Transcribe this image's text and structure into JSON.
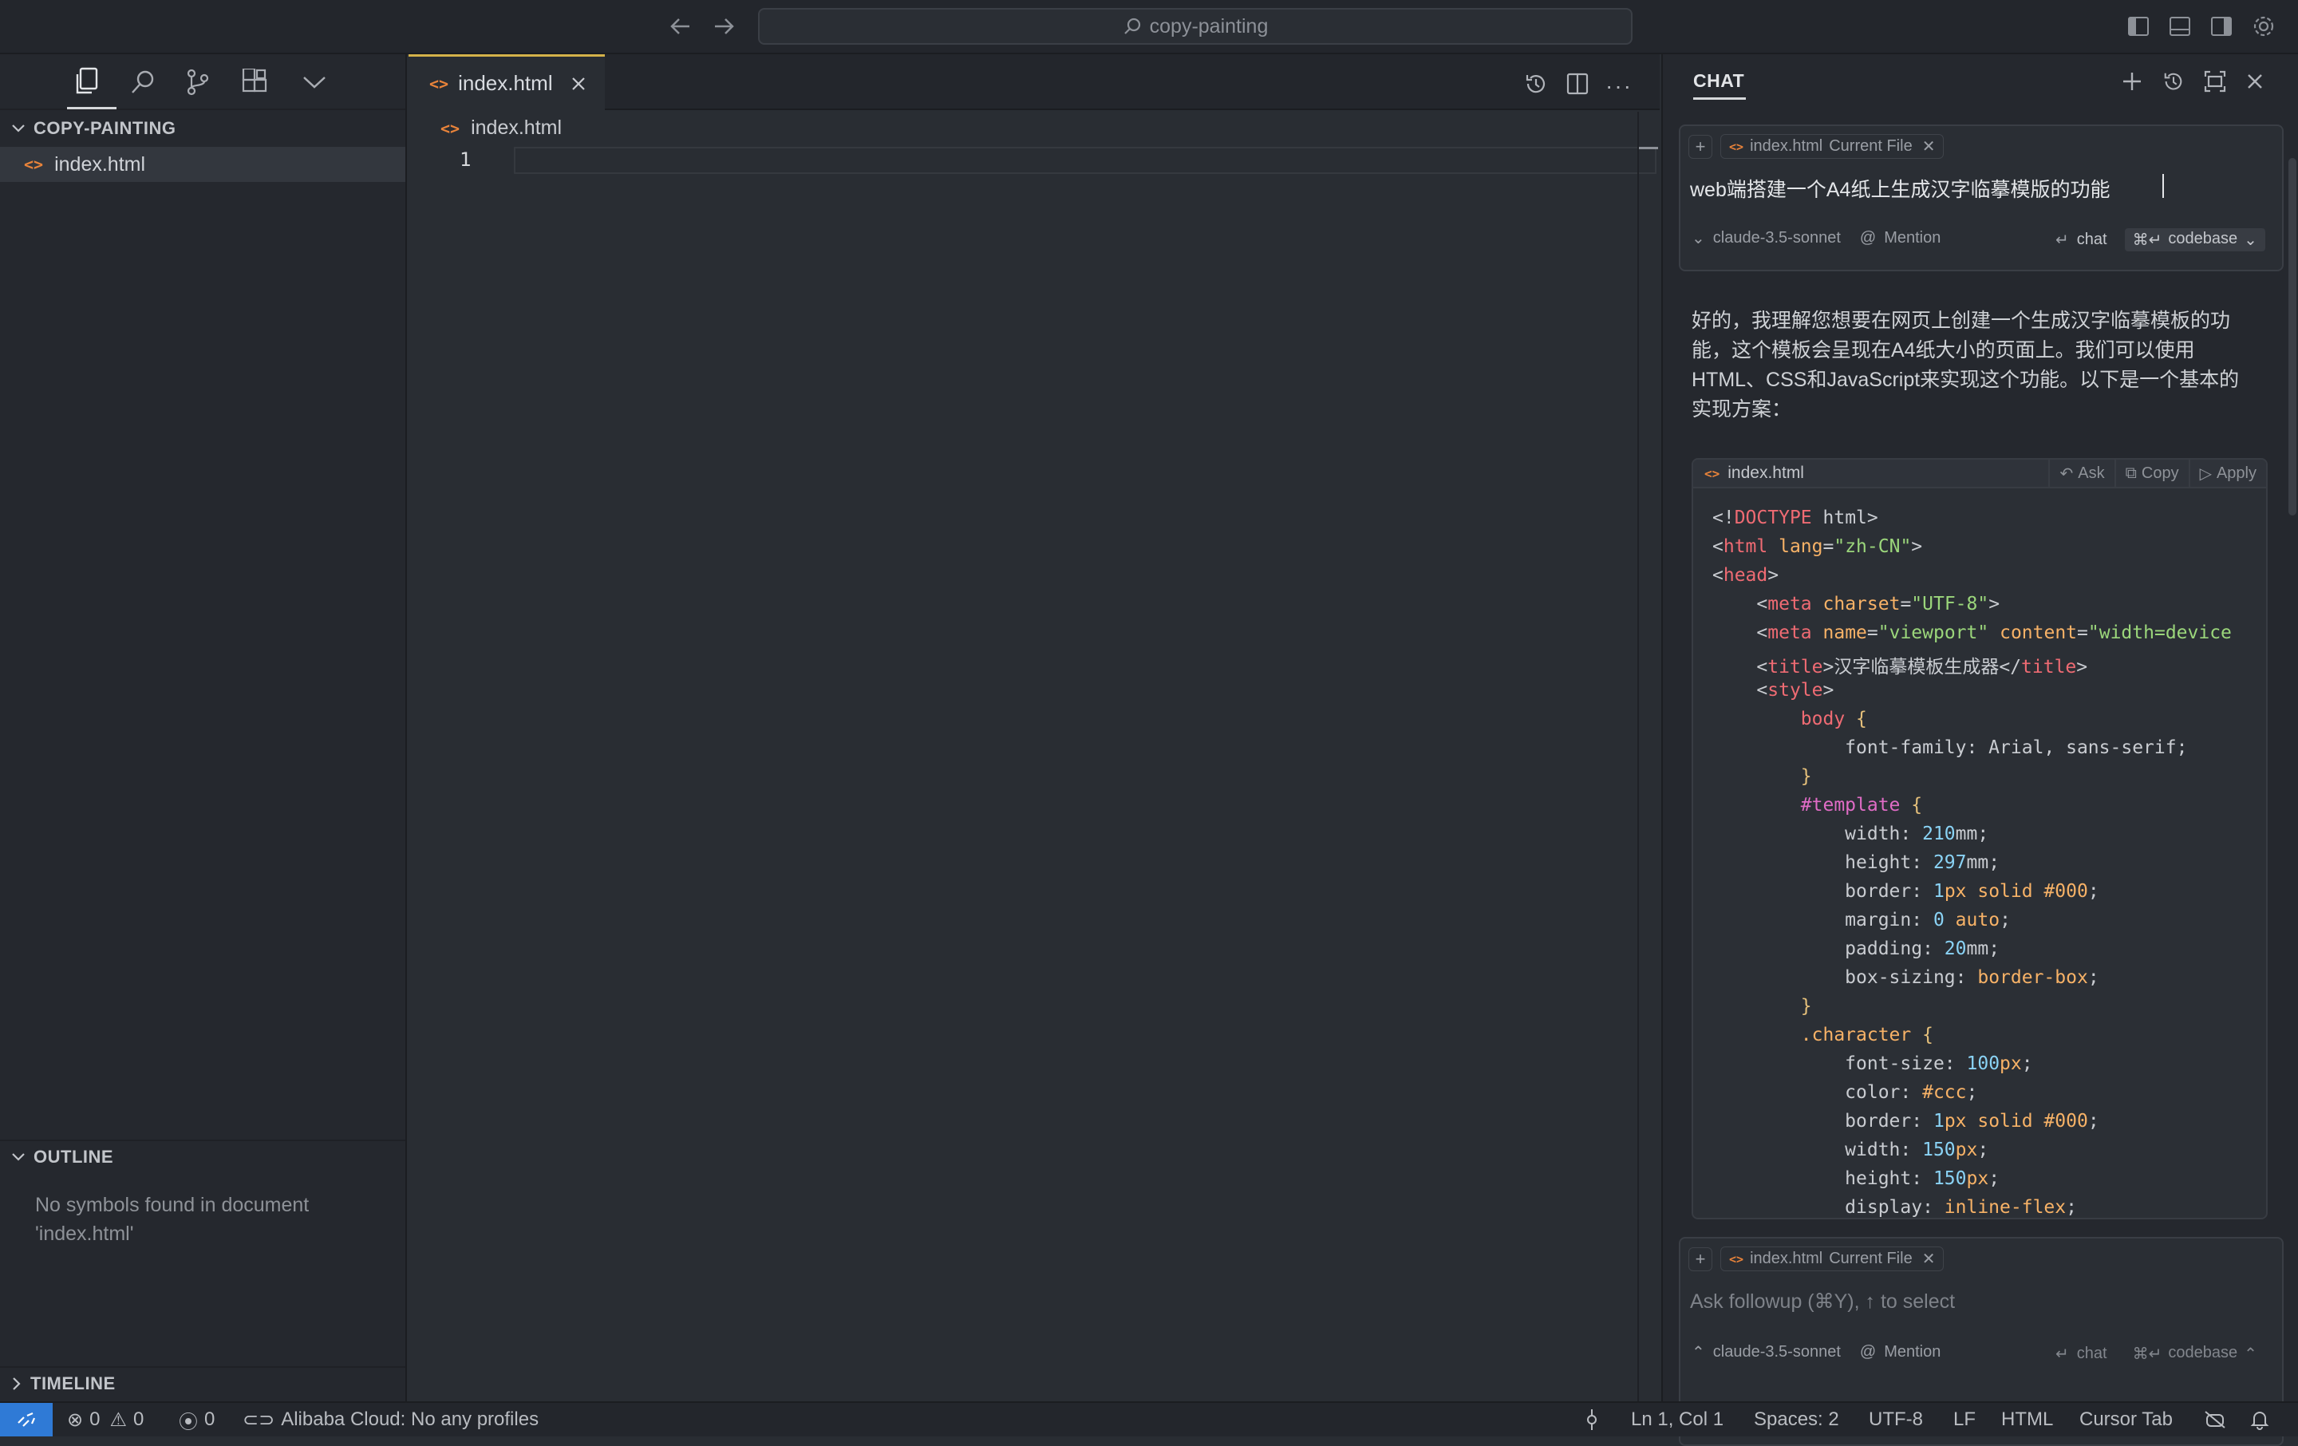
{
  "titlebar": {
    "search_text": "copy-painting"
  },
  "sidebar": {
    "project": "COPY-PAINTING",
    "files": [
      {
        "name": "index.html"
      }
    ],
    "outline_header": "OUTLINE",
    "outline_empty_1": "No symbols found in document",
    "outline_empty_2": "'index.html'",
    "timeline_header": "TIMELINE"
  },
  "editor": {
    "tab_label": "index.html",
    "breadcrumb": "index.html",
    "line_number": "1"
  },
  "chat": {
    "title": "CHAT",
    "context_file": "index.html",
    "context_tag": "Current File",
    "prompt_text": "web端搭建一个A4纸上生成汉字临摹模版的功能",
    "model": "claude-3.5-sonnet",
    "mention": "Mention",
    "chat_btn": "chat",
    "codebase_btn": "codebase",
    "response_lines": [
      "好的，我理解您想要在网页上创建一个生成汉字临摹模板的功",
      "能，这个模板会呈现在A4纸大小的页面上。我们可以使用",
      "HTML、CSS和JavaScript来实现这个功能。以下是一个基本的",
      "实现方案："
    ],
    "code_file": "index.html",
    "code_actions": {
      "ask": "Ask",
      "copy": "Copy",
      "apply": "Apply"
    },
    "followup_placeholder": "Ask followup (⌘Y), ↑ to select"
  },
  "statusbar": {
    "errors": "0",
    "warnings": "0",
    "ports": "0",
    "cloud": "Alibaba Cloud: No any profiles",
    "position": "Ln 1, Col 1",
    "spaces": "Spaces: 2",
    "encoding": "UTF-8",
    "eol": "LF",
    "language": "HTML",
    "cursor_tab": "Cursor Tab"
  },
  "colors": {
    "accent": "#2f7ad6",
    "tab_indicator": "#d4b24a",
    "html_icon": "#e8833a"
  }
}
